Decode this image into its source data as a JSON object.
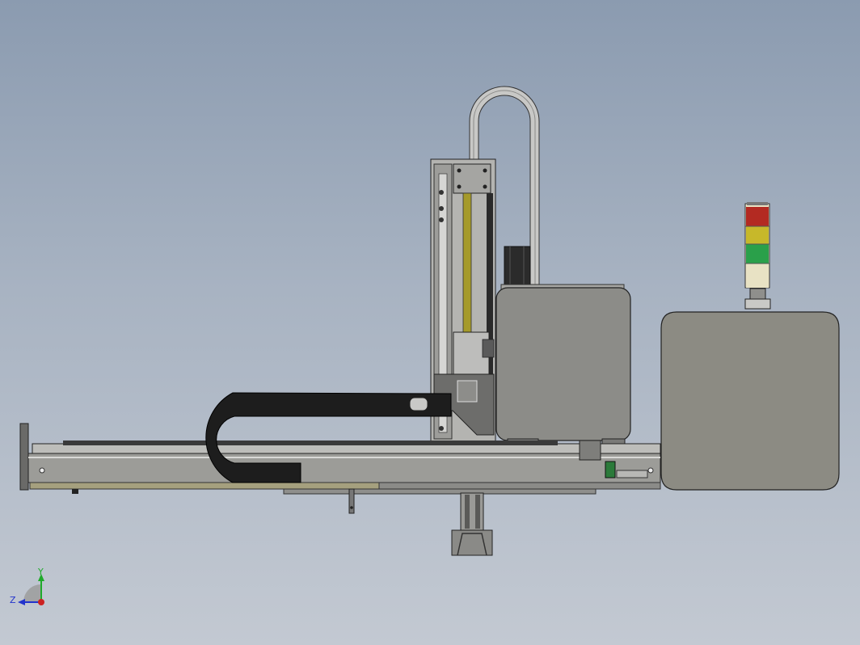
{
  "viewport": {
    "background_top": "#8b9bb0",
    "background_bottom": "#c3c9d2"
  },
  "model": {
    "components": [
      "base-rail",
      "cable-chain",
      "vertical-column",
      "vertical-cable-loop",
      "motor-housing",
      "control-cabinet",
      "signal-tower",
      "gripper"
    ],
    "colors": {
      "body_gray": "#8c8c88",
      "frame_gray": "#a9a9a6",
      "cable_chain": "#1d1d1d",
      "slide_yellow": "#a59a2a",
      "tower_red": "#b32a22",
      "tower_yellow": "#c7b82a",
      "tower_green": "#2aa04a",
      "tower_white": "#e8e2c4"
    }
  },
  "triad": {
    "y_label": "Y",
    "z_label": "Z",
    "colors": {
      "y": "#1faa2a",
      "z": "#2233cc",
      "origin": "#cc2222"
    }
  }
}
